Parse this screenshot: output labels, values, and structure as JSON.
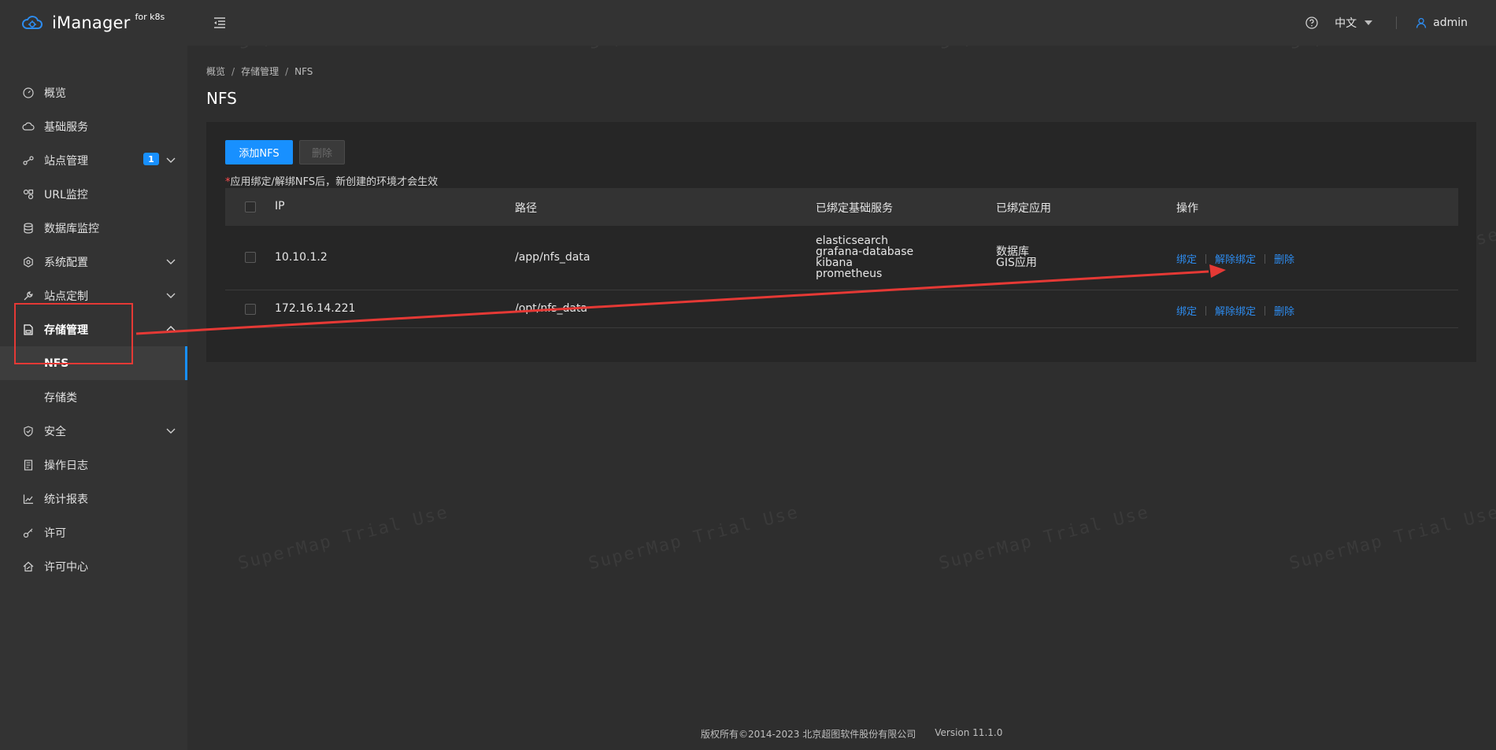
{
  "header": {
    "brand_name": "iManager",
    "brand_sub": "for k8s",
    "language": "中文",
    "user": "admin"
  },
  "sidebar": {
    "items": [
      {
        "label": "概览",
        "icon": "dashboard-icon"
      },
      {
        "label": "基础服务",
        "icon": "cloud-service-icon"
      },
      {
        "label": "站点管理",
        "icon": "site-nodes-icon",
        "badge": "1"
      },
      {
        "label": "URL监控",
        "icon": "url-monitor-icon"
      },
      {
        "label": "数据库监控",
        "icon": "database-icon"
      },
      {
        "label": "系统配置",
        "icon": "gear-icon"
      },
      {
        "label": "站点定制",
        "icon": "wrench-icon"
      },
      {
        "label": "存储管理",
        "icon": "storage-icon"
      },
      {
        "label": "安全",
        "icon": "shield-icon"
      },
      {
        "label": "操作日志",
        "icon": "log-icon"
      },
      {
        "label": "统计报表",
        "icon": "chart-icon"
      },
      {
        "label": "许可",
        "icon": "key-icon"
      },
      {
        "label": "许可中心",
        "icon": "license-center-icon"
      }
    ],
    "storage_sub": {
      "nfs": "NFS",
      "storage_class": "存储类"
    }
  },
  "breadcrumb": [
    "概览",
    "存储管理",
    "NFS"
  ],
  "page_title": "NFS",
  "toolbar": {
    "add_label": "添加NFS",
    "delete_label": "删除",
    "notice_star": "*",
    "notice_text": "应用绑定/解绑NFS后，新创建的环境才会生效"
  },
  "table": {
    "headers": {
      "ip": "IP",
      "path": "路径",
      "bound_services": "已绑定基础服务",
      "bound_apps": "已绑定应用",
      "actions": "操作"
    },
    "rows": [
      {
        "ip": "10.10.1.2",
        "path": "/app/nfs_data",
        "services": [
          "elasticsearch",
          "grafana-database",
          "kibana",
          "prometheus"
        ],
        "apps": [
          "数据库",
          "GIS应用"
        ]
      },
      {
        "ip": "172.16.14.221",
        "path": "/opt/nfs_data",
        "services": [],
        "apps": []
      }
    ],
    "actions": {
      "bind": "绑定",
      "unbind": "解除绑定",
      "delete": "删除"
    }
  },
  "footer": {
    "copyright": "版权所有©2014-2023 北京超图软件股份有限公司",
    "version": "Version 11.1.0"
  },
  "watermark": "SuperMap Trial Use",
  "colors": {
    "accent": "#1890ff",
    "link": "#2d8cf0",
    "annotation": "#e53935"
  }
}
